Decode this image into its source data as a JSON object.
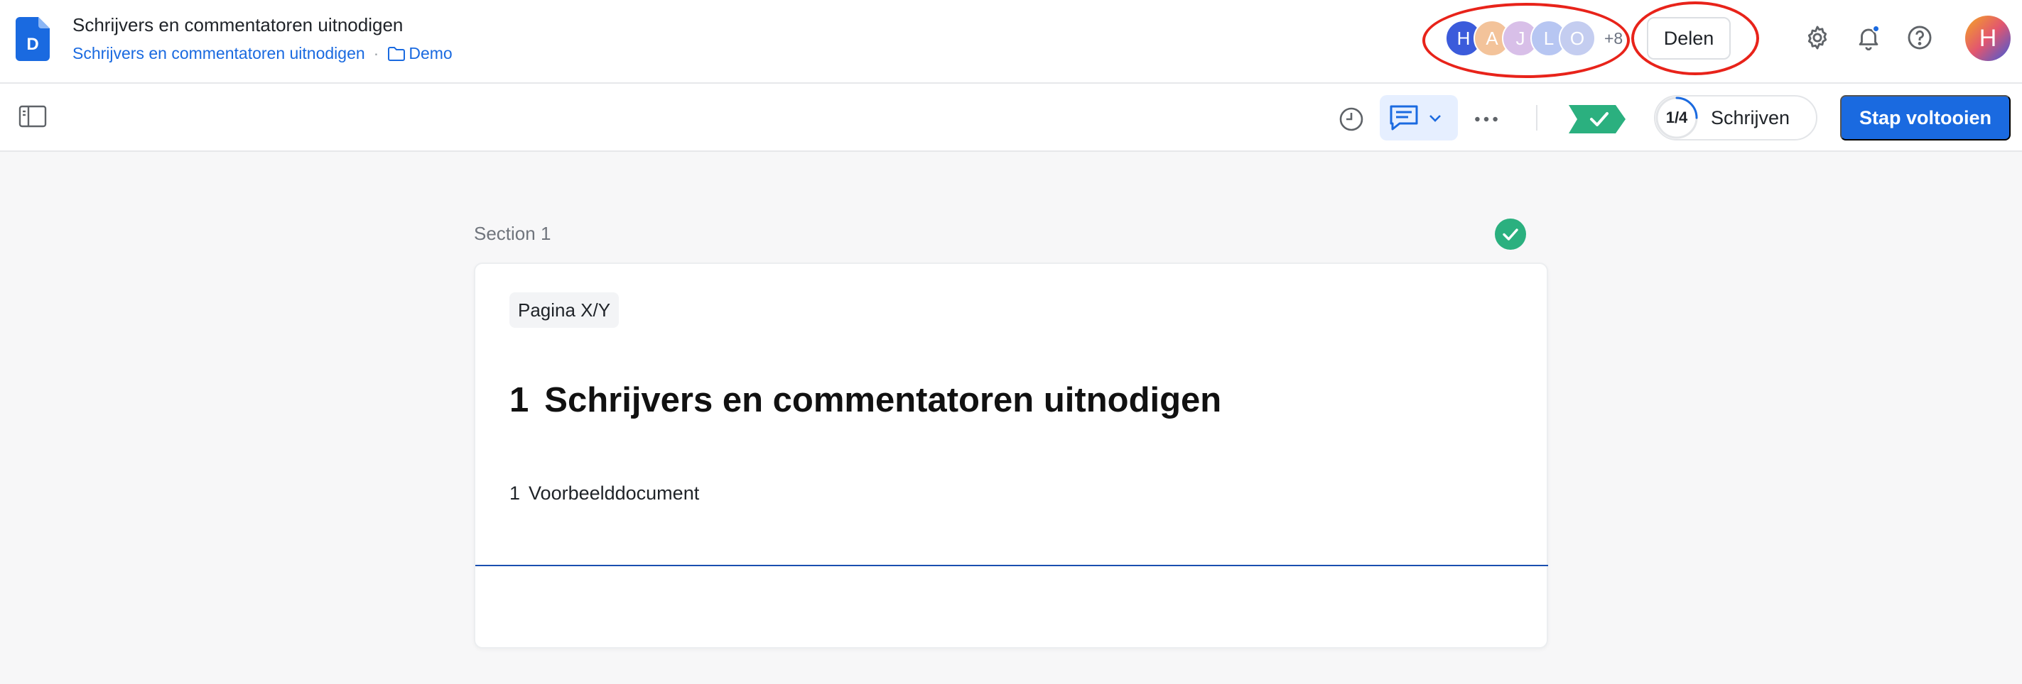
{
  "header": {
    "title": "Schrijvers en commentatoren uitnodigen",
    "breadcrumb": {
      "document": "Schrijvers en commentatoren uitnodigen",
      "separator": "·",
      "folder": "Demo"
    },
    "collaborators": [
      {
        "initial": "H",
        "color": "#3b5bdb"
      },
      {
        "initial": "A",
        "color": "#f3c39a"
      },
      {
        "initial": "J",
        "color": "#d8bfe8"
      },
      {
        "initial": "L",
        "color": "#b7c6f2"
      },
      {
        "initial": "O",
        "color": "#c4cdf0"
      }
    ],
    "collaborators_more": "+8",
    "share_label": "Delen",
    "user_initial": "H",
    "icons": [
      "settings-icon",
      "bell-icon",
      "help-icon"
    ]
  },
  "toolbar": {
    "step_progress": "1/4",
    "step_fraction": 0.25,
    "step_name": "Schrijven",
    "complete_label": "Stap voltooien",
    "accent": "#1a6ae0",
    "status_color": "#2bb07f"
  },
  "content": {
    "section_label": "Section 1",
    "page_tag": "Pagina X/Y",
    "heading_number": "1",
    "heading_text": "Schrijvers en commentatoren uitnodigen",
    "item_number": "1",
    "item_text": "Voorbeelddocument"
  },
  "annotation_color": "#e8231a"
}
